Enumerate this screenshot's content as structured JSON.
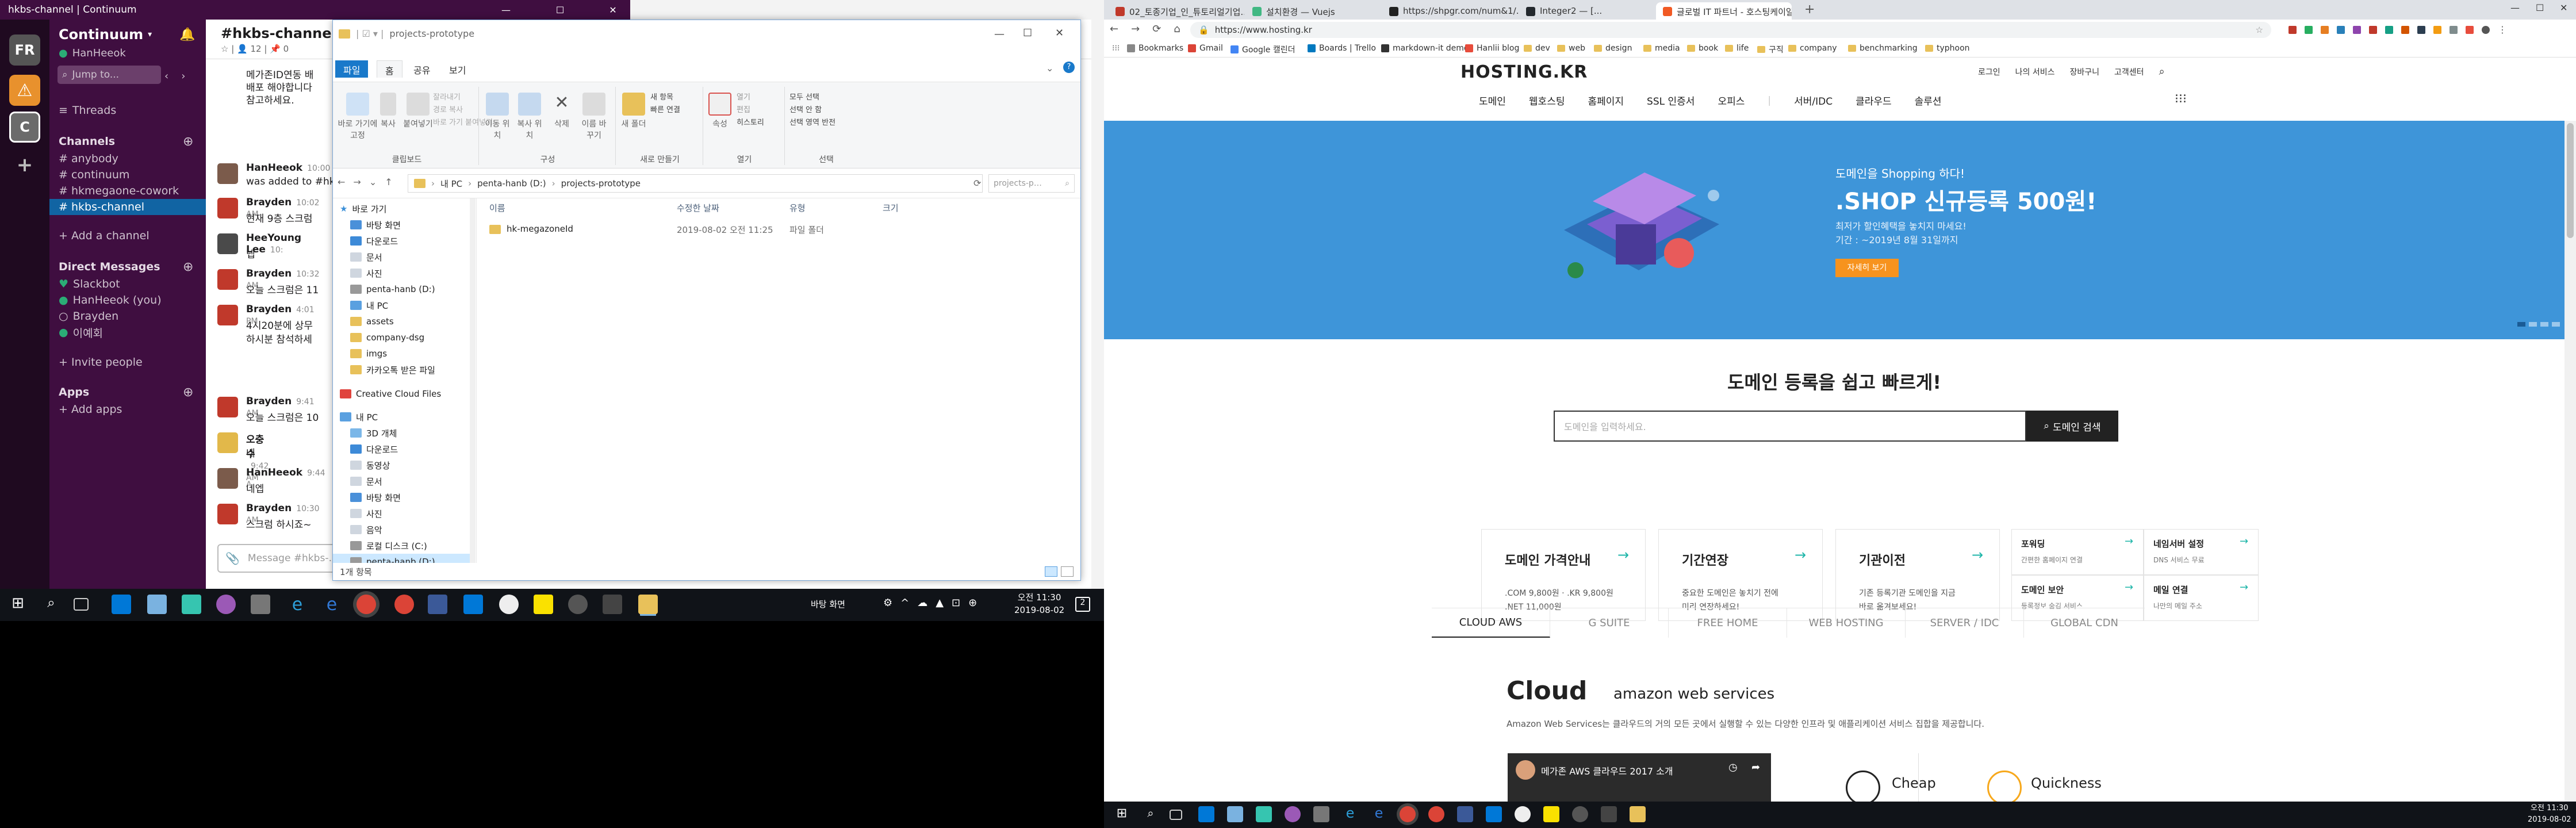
{
  "slack": {
    "window_title": "hkbs-channel | Continuum",
    "workspace_letters": [
      "FR",
      "C"
    ],
    "workspace_name": "Continuum",
    "user_name": "HanHeeok",
    "jump_to": "Jump to...",
    "threads": "Threads",
    "channels_header": "Channels",
    "channels": [
      "# anybody",
      "# continuum",
      "# hkmegaone-cowork",
      "# hkbs-channel"
    ],
    "add_channel": "+ Add a channel",
    "dm_header": "Direct Messages",
    "dms": [
      "Slackbot",
      "HanHeeok (you)",
      "Brayden",
      "이예회"
    ],
    "invite": "+ Invite people",
    "apps_header": "Apps",
    "add_apps": "+ Add apps",
    "channel_title": "#hkbs-channel",
    "channel_meta": "☆ | 👤 12 | 📌 0",
    "composer_placeholder": "Message #hkbs-…",
    "messages": [
      {
        "name": "",
        "time": "",
        "text": "메가존ID연동 배",
        "text2": "배포 해야합니다",
        "text3": "참고하세요."
      },
      {
        "name": "HanHeeok",
        "time": "10:00",
        "text": "was added to #hk"
      },
      {
        "name": "Brayden",
        "time": "10:02 AM",
        "text": "현재 9층 스크럼"
      },
      {
        "name": "HeeYoung Lee",
        "time": "10:",
        "text": "넵"
      },
      {
        "name": "Brayden",
        "time": "10:32 AM",
        "text": "오늘 스크럼은 11"
      },
      {
        "name": "Brayden",
        "time": "4:01 PM",
        "text": "4시20분에 상무",
        "text2": "하시분 참석하세"
      },
      {
        "name": "Brayden",
        "time": "9:41 AM",
        "text": "오늘 스크럼은 10"
      },
      {
        "name": "오충수",
        "time": "9:42 AM",
        "text": "네"
      },
      {
        "name": "HanHeeok",
        "time": "9:44 A",
        "text": "네엡"
      },
      {
        "name": "Brayden",
        "time": "10:30 AM",
        "text": "스크럼 하시죠~"
      }
    ]
  },
  "explorer": {
    "title": "projects-prototype",
    "tabs": [
      "파일",
      "홈",
      "공유",
      "보기"
    ],
    "ribbon_groups": [
      "클립보드",
      "구성",
      "새로 만들기",
      "열기",
      "선택"
    ],
    "ribbon_buttons": {
      "pin": "바로 가기에 고정",
      "copy": "복사",
      "paste": "붙여넣기",
      "cut": "잘라내기",
      "copy_path": "경로 복사",
      "paste_shortcut": "바로 가기 붙여넣기",
      "move_to": "이동 위치",
      "copy_to": "복사 위치",
      "delete": "삭제",
      "rename": "이름 바꾸기",
      "new_folder": "새 폴더",
      "new_item": "새 항목",
      "easy_access": "빠른 연결",
      "properties": "속성",
      "open": "열기",
      "edit": "편집",
      "history": "히스토리",
      "select_all": "모두 선택",
      "select_none": "선택 안 함",
      "invert": "선택 영역 반전"
    },
    "breadcrumb": [
      "내 PC",
      "penta-hanb (D:)",
      "projects-prototype"
    ],
    "search_placeholder": "projects-p…",
    "nav_items": [
      "바로 가기",
      "바탕 화면",
      "다운로드",
      "문서",
      "사진",
      "penta-hanb (D:)",
      "내 PC",
      "assets",
      "company-dsg",
      "imgs",
      "카카오톡 받은 파일",
      "Creative Cloud Files",
      "내 PC",
      "3D 개체",
      "다운로드",
      "동영상",
      "문서",
      "바탕 화면",
      "사진",
      "음악",
      "로컬 디스크 (C:)",
      "penta-hanb (D:)"
    ],
    "columns": [
      "이름",
      "수정한 날짜",
      "유형",
      "크기"
    ],
    "files": [
      {
        "name": "hk-megazoneId",
        "date": "2019-08-02 오전 11:25",
        "type": "파일 폴더",
        "size": ""
      }
    ],
    "status": "1개 항목"
  },
  "taskbar_left": {
    "desktop_label": "바탕 화면",
    "time": "오전 11:30",
    "date": "2019-08-02"
  },
  "chrome": {
    "tabs": [
      "02_토종기업_인_튜토리얼기업...",
      "설치환경 — Vuejs",
      "https://shpgr.com/num&1/...",
      "Integer2 — [...",
      "글로벌 IT 파트너 - 호스팅케이알"
    ],
    "url": "https://www.hosting.kr",
    "bookmarks": [
      "Bookmarks",
      "Gmail",
      "Google 캘린더",
      "Boards | Trello",
      "markdown-it demo",
      "Hanlii blog",
      "dev",
      "web",
      "design",
      "media",
      "book",
      "life",
      "구직",
      "company",
      "benchmarking",
      "typhoon"
    ]
  },
  "site": {
    "logo": "HOSTING.KR",
    "top_links": [
      "로그인",
      "나의 서비스",
      "장바구니",
      "고객센터"
    ],
    "nav": [
      "도메인",
      "웹호스팅",
      "홈페이지",
      "SSL 인증서",
      "오피스",
      "서버/IDC",
      "클라우드",
      "솔루션"
    ],
    "hero_eyebrow": "도메인을 Shopping 하다!",
    "hero_title": ".SHOP 신규등록 500원!",
    "hero_desc1": "최저가 할인혜택을 놓치지 마세요!",
    "hero_desc2": "기간 : ~2019년 8월 31일까지",
    "hero_button": "자세히 보기",
    "search_title": "도메인 등록을 쉽고 빠르게!",
    "search_placeholder": "도메인을 입력하세요.",
    "search_button": "도메인 검색",
    "cards": [
      {
        "title": "도메인 가격안내",
        "desc1": ".COM 9,800원 · .KR 9,800원",
        "desc2": ".NET 11,000원"
      },
      {
        "title": "기간연장",
        "desc1": "중요한 도메인은 놓치기 전에",
        "desc2": "미리 연장하세요!"
      },
      {
        "title": "기관이전",
        "desc1": "기존 등록기관 도메인을 지금",
        "desc2": "바로 옮겨보세요!"
      }
    ],
    "mini_cards": [
      {
        "title": "포워딩",
        "desc": "간편한 홈페이지 연결"
      },
      {
        "title": "네임서버 설정",
        "desc": "DNS 서비스 무료"
      },
      {
        "title": "도메인 보안",
        "desc": "등록정보 숨김 서비스"
      },
      {
        "title": "메일 연결",
        "desc": "나만의 메일 주소"
      }
    ],
    "service_tabs": [
      "CLOUD AWS",
      "G SUITE",
      "FREE HOME",
      "WEB HOSTING",
      "SERVER / IDC",
      "GLOBAL CDN"
    ],
    "cloud_title": "Cloud",
    "cloud_sub": "amazon web services",
    "cloud_desc": "Amazon Web Services는 클라우드의 거의 모든 곳에서 실행할 수 있는 다양한 인프라 및 애플리케이션 서비스 집합을 제공합니다.",
    "video_title": "메가존 AWS 클라우드 2017 소개",
    "features": [
      "Cheap",
      "Quickness"
    ]
  },
  "taskbar_right": {
    "time": "오전 11:30",
    "date": "2019-08-02"
  }
}
